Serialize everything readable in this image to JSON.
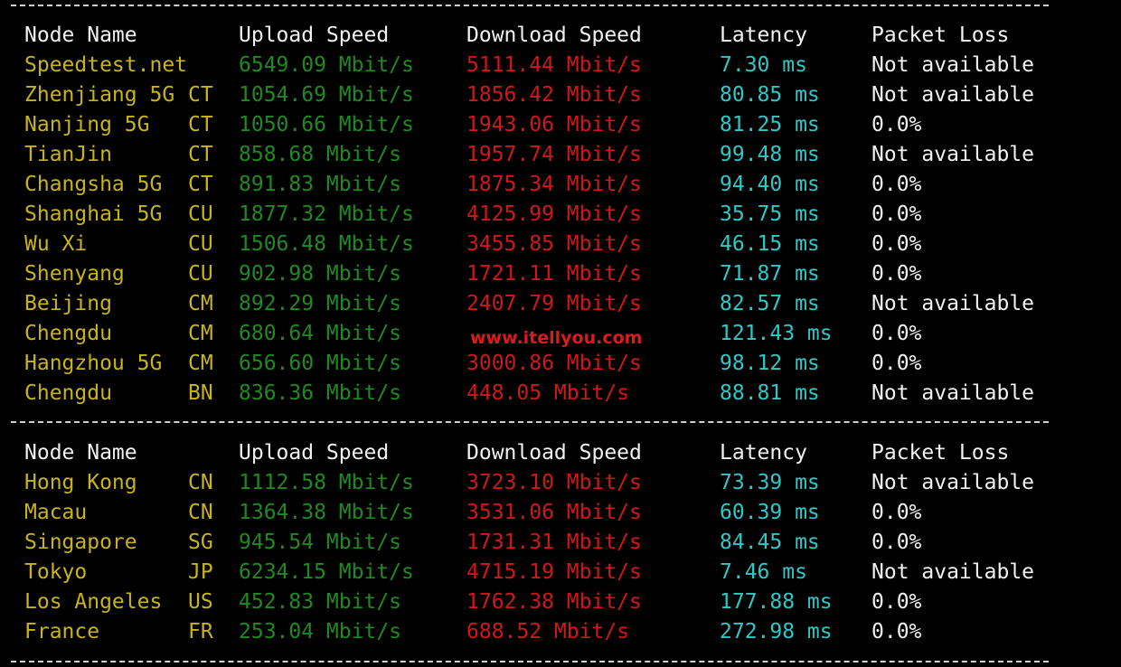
{
  "colors": {
    "background": "#000000",
    "header_text": "#f2f2f2",
    "node_name": "#c8b418",
    "upload": "#1f8a1f",
    "download": "#d01818",
    "latency": "#2ec8c8",
    "packet_loss": "#f2f2f2",
    "separator": "#d0d0d0",
    "watermark": "#ff2020"
  },
  "header": {
    "node_name": "Node Name",
    "upload": "Upload Speed",
    "download": "Download Speed",
    "latency": "Latency",
    "packet_loss": "Packet Loss"
  },
  "table1": [
    {
      "node": "Speedtest.net",
      "isp": "",
      "upload": "6549.09 Mbit/s",
      "download": "5111.44 Mbit/s",
      "latency": "7.30 ms",
      "loss": "Not available"
    },
    {
      "node": "Zhenjiang 5G",
      "isp": "CT",
      "upload": "1054.69 Mbit/s",
      "download": "1856.42 Mbit/s",
      "latency": "80.85 ms",
      "loss": "Not available"
    },
    {
      "node": "Nanjing 5G",
      "isp": "CT",
      "upload": "1050.66 Mbit/s",
      "download": "1943.06 Mbit/s",
      "latency": "81.25 ms",
      "loss": "0.0%"
    },
    {
      "node": "TianJin",
      "isp": "CT",
      "upload": "858.68 Mbit/s",
      "download": "1957.74 Mbit/s",
      "latency": "99.48 ms",
      "loss": "Not available"
    },
    {
      "node": "Changsha 5G",
      "isp": "CT",
      "upload": "891.83 Mbit/s",
      "download": "1875.34 Mbit/s",
      "latency": "94.40 ms",
      "loss": "0.0%"
    },
    {
      "node": "Shanghai 5G",
      "isp": "CU",
      "upload": "1877.32 Mbit/s",
      "download": "4125.99 Mbit/s",
      "latency": "35.75 ms",
      "loss": "0.0%"
    },
    {
      "node": "Wu Xi",
      "isp": "CU",
      "upload": "1506.48 Mbit/s",
      "download": "3455.85 Mbit/s",
      "latency": "46.15 ms",
      "loss": "0.0%"
    },
    {
      "node": "Shenyang",
      "isp": "CU",
      "upload": "902.98 Mbit/s",
      "download": "1721.11 Mbit/s",
      "latency": "71.87 ms",
      "loss": "0.0%"
    },
    {
      "node": "Beijing",
      "isp": "CM",
      "upload": "892.29 Mbit/s",
      "download": "2407.79 Mbit/s",
      "latency": "82.57 ms",
      "loss": "Not available"
    },
    {
      "node": "Chengdu",
      "isp": "CM",
      "upload": "680.64 Mbit/s",
      "download": "",
      "latency": "121.43 ms",
      "loss": "0.0%"
    },
    {
      "node": "Hangzhou 5G",
      "isp": "CM",
      "upload": "656.60 Mbit/s",
      "download": "3000.86 Mbit/s",
      "latency": "98.12 ms",
      "loss": "0.0%"
    },
    {
      "node": "Chengdu",
      "isp": "BN",
      "upload": "836.36 Mbit/s",
      "download": "448.05 Mbit/s",
      "latency": "88.81 ms",
      "loss": "Not available"
    }
  ],
  "table2": [
    {
      "node": "Hong Kong",
      "isp": "CN",
      "upload": "1112.58 Mbit/s",
      "download": "3723.10 Mbit/s",
      "latency": "73.39 ms",
      "loss": "Not available"
    },
    {
      "node": "Macau",
      "isp": "CN",
      "upload": "1364.38 Mbit/s",
      "download": "3531.06 Mbit/s",
      "latency": "60.39 ms",
      "loss": "0.0%"
    },
    {
      "node": "Singapore",
      "isp": "SG",
      "upload": "945.54 Mbit/s",
      "download": "1731.31 Mbit/s",
      "latency": "84.45 ms",
      "loss": "0.0%"
    },
    {
      "node": "Tokyo",
      "isp": "JP",
      "upload": "6234.15 Mbit/s",
      "download": "4715.19 Mbit/s",
      "latency": "7.46 ms",
      "loss": "Not available"
    },
    {
      "node": "Los Angeles",
      "isp": "US",
      "upload": "452.83 Mbit/s",
      "download": "1762.38 Mbit/s",
      "latency": "177.88 ms",
      "loss": "0.0%"
    },
    {
      "node": "France",
      "isp": "FR",
      "upload": "253.04 Mbit/s",
      "download": "688.52 Mbit/s",
      "latency": "272.98 ms",
      "loss": "0.0%"
    }
  ],
  "watermark": "www.itellyou.com"
}
